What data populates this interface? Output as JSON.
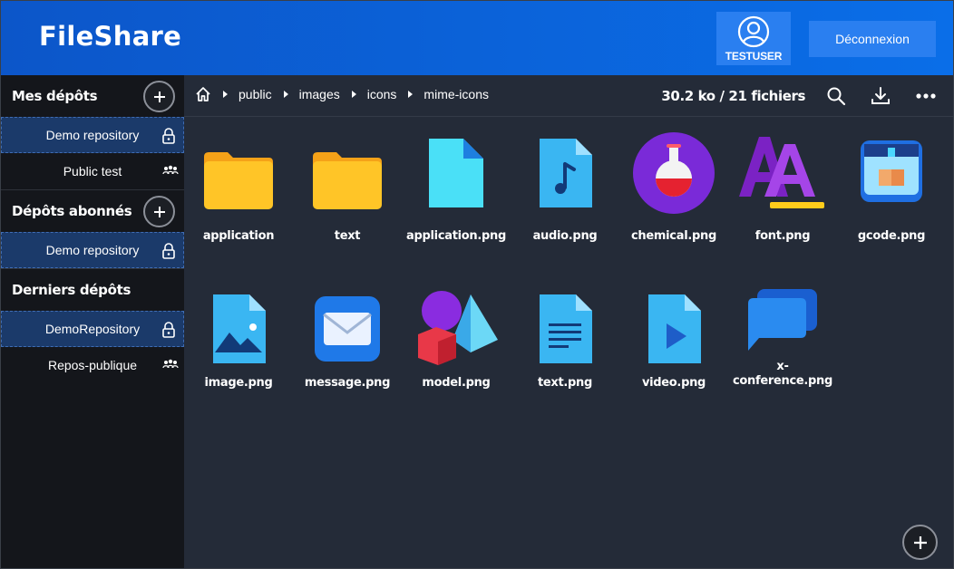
{
  "header": {
    "brand": "FileShare",
    "user": "TESTUSER",
    "logout_label": "Déconnexion"
  },
  "sidebar": {
    "sections": [
      {
        "title": "Mes dépôts",
        "has_add": true,
        "repos": [
          {
            "name": "Demo repository",
            "selected": true,
            "icon": "lock-icon"
          },
          {
            "name": "Public test",
            "selected": false,
            "icon": "people-icon"
          }
        ]
      },
      {
        "title": "Dépôts abonnés",
        "has_add": true,
        "repos": [
          {
            "name": "Demo repository",
            "selected": true,
            "icon": "lock-icon"
          }
        ]
      },
      {
        "title": "Derniers dépôts",
        "has_add": false,
        "repos": [
          {
            "name": "DemoRepository",
            "selected": true,
            "icon": "lock-icon"
          },
          {
            "name": "Repos-publique",
            "selected": false,
            "icon": "people-icon"
          }
        ]
      }
    ]
  },
  "toolbar": {
    "breadcrumb": [
      "public",
      "images",
      "icons",
      "mime-icons"
    ],
    "stats": "30.2 ko / 21 fichiers"
  },
  "files": [
    {
      "name": "application",
      "icon": "folder-icon"
    },
    {
      "name": "text",
      "icon": "folder-icon"
    },
    {
      "name": "application.png",
      "icon": "generic-file-icon"
    },
    {
      "name": "audio.png",
      "icon": "audio-file-icon"
    },
    {
      "name": "chemical.png",
      "icon": "flask-icon"
    },
    {
      "name": "font.png",
      "icon": "font-icon"
    },
    {
      "name": "gcode.png",
      "icon": "3d-printer-icon"
    },
    {
      "name": "image.png",
      "icon": "image-file-icon"
    },
    {
      "name": "message.png",
      "icon": "envelope-icon"
    },
    {
      "name": "model.png",
      "icon": "3d-shapes-icon"
    },
    {
      "name": "text.png",
      "icon": "text-file-icon"
    },
    {
      "name": "video.png",
      "icon": "video-file-icon"
    },
    {
      "name": "x-conference.png",
      "icon": "chat-bubbles-icon"
    }
  ],
  "colors": {
    "header_from": "#0c56c9",
    "header_to": "#0a6ee8",
    "button": "#2a7ff0",
    "sidebar": "#14161b",
    "main": "#242b38",
    "selected": "#1b3a6a",
    "folder": "#ffc527"
  }
}
